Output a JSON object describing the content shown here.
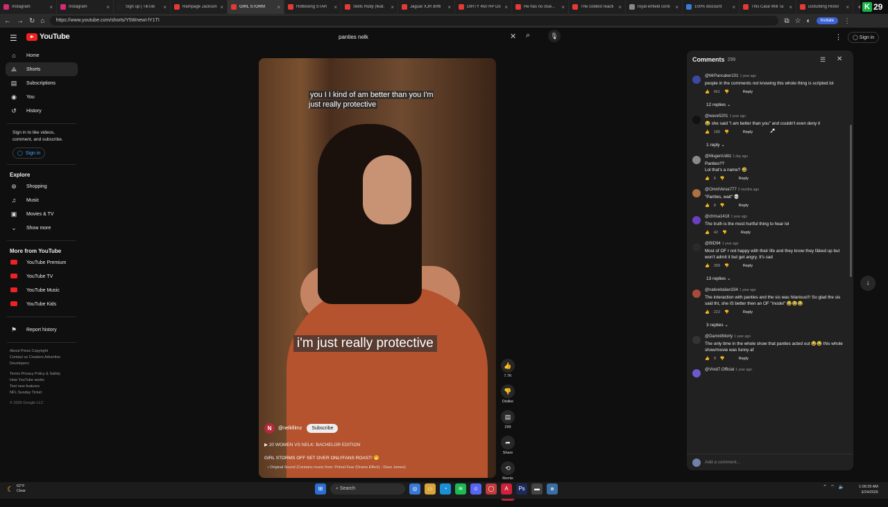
{
  "browser": {
    "tabs": [
      {
        "label": "Instagram",
        "color": "#d62976"
      },
      {
        "label": "Instagram",
        "color": "#d62976"
      },
      {
        "label": "Sign up | TikTok",
        "color": "#222222"
      },
      {
        "label": "Rampage Jackson",
        "color": "#e53935"
      },
      {
        "label": "GIRL STORM",
        "color": "#e53935"
      },
      {
        "label": "Hotboxing STAR",
        "color": "#e53935"
      },
      {
        "label": "Skills Ruby (feat.",
        "color": "#e53935"
      },
      {
        "label": "Jaguar XJR drifti",
        "color": "#e53935"
      },
      {
        "label": "DIRTY 450 HP Do",
        "color": "#e53935"
      },
      {
        "label": "He has no clue...",
        "color": "#e53935"
      },
      {
        "label": "The coldest reacti",
        "color": "#e53935"
      },
      {
        "label": "royal enfield conti",
        "color": "#888888"
      },
      {
        "label": "100% discount",
        "color": "#3a7bd5"
      },
      {
        "label": "This Case Will Ta",
        "color": "#e53935"
      },
      {
        "label": "Disturbing Histor",
        "color": "#e53935"
      }
    ],
    "new_tab": "+",
    "badge_letter": "K",
    "badge_count": "29",
    "url": "https://www.youtube.com/shorts/Y5WnewI-lY1TI",
    "invite_label": "Invitate"
  },
  "header": {
    "logo_text": "YouTube",
    "search_query": "panties nelk",
    "sign_in": "Sign in"
  },
  "sidebar": {
    "primary": [
      {
        "label": "Home",
        "icon": "⌂"
      },
      {
        "label": "Shorts",
        "icon": "⟁"
      },
      {
        "label": "Subscriptions",
        "icon": "▤"
      },
      {
        "label": "You",
        "icon": "◉"
      },
      {
        "label": "History",
        "icon": "↺"
      }
    ],
    "signin_prompt": "Sign in to like videos, comment, and subscribe.",
    "signin_button": "Sign in",
    "explore_title": "Explore",
    "explore": [
      {
        "label": "Shopping",
        "icon": "⊛"
      },
      {
        "label": "Music",
        "icon": "♫"
      },
      {
        "label": "Movies & TV",
        "icon": "▣"
      },
      {
        "label": "Show more",
        "icon": "⌄"
      }
    ],
    "more_title": "More from YouTube",
    "more": [
      {
        "label": "YouTube Premium"
      },
      {
        "label": "YouTube TV"
      },
      {
        "label": "YouTube Music"
      },
      {
        "label": "YouTube Kids"
      }
    ],
    "report": "Report history",
    "footer1": "About  Press  Copyright",
    "footer2": "Contact us  Creators  Advertise",
    "footer3": "Developers",
    "footer4": "Terms  Privacy  Policy & Safety",
    "footer5": "How YouTube works",
    "footer6": "Test new features",
    "footer7": "NFL Sunday Ticket",
    "copyright": "© 2026 Google LLC"
  },
  "video": {
    "caption_top": "you I I kind of am better than you I'm just really protective",
    "caption_main": "i'm just really protective",
    "channel_initial": "N",
    "channel": "@nelkfilmz",
    "subscribe": "Subscribe",
    "playlist": "20 WOMEN VS NELK: BACHELOR EDITION",
    "title": "GIRL STORMS OFF SET OVER ONLYFANS ROAST! 🤭",
    "sound": "Original Sound (Contains music from: Primal Fear (Drams Effect) - Dave James)"
  },
  "actions": {
    "likes": "7.7K",
    "dislike": "Dislike",
    "comments": "299",
    "share": "Share",
    "remix": "Remix"
  },
  "comments": {
    "title": "Comments",
    "count": "299",
    "items": [
      {
        "user": "@MrPancaker101",
        "ago": "1 year ago",
        "text": "people in the comments not knowing this whole thing is scripted lol",
        "likes": "661",
        "reply": "Reply",
        "replies": "12 replies",
        "color": "#3b4aa0"
      },
      {
        "user": "@wave5201",
        "ago": "1 year ago",
        "text": "😂 she said \"i am better than you\" and couldn't even deny it",
        "likes": "185",
        "reply": "Reply",
        "replies": "1 reply",
        "color": "#111111"
      },
      {
        "user": "@MugenUditz",
        "ago": "1 day ago",
        "text": "Panties??\nLol that's a name? 🤣",
        "likes": "6",
        "reply": "Reply",
        "replies": "",
        "color": "#8a8a8a"
      },
      {
        "user": "@OmniVerse777",
        "ago": "2 months ago",
        "text": "\"Panties, wait\" 💀",
        "likes": "8",
        "reply": "Reply",
        "replies": "",
        "color": "#b07040"
      },
      {
        "user": "@chrisa1418",
        "ago": "1 year ago",
        "text": "The truth is the most hurtful thing to hear lol",
        "likes": "42",
        "reply": "Reply",
        "replies": "",
        "color": "#6a3fc0"
      },
      {
        "user": "@BID94",
        "ago": "1 year ago",
        "text": "Most of OF r not happy with their life and they know they f&ked up but won't admit it but get angry. It's sad",
        "likes": "309",
        "reply": "Reply",
        "replies": "13 replies",
        "color": "#2a2a2a"
      },
      {
        "user": "@nativeitalian334",
        "ago": "1 year ago",
        "text": "The interaction with panties and the sis was hilarious!!! So glad the sis said tht, she IS better then an OF \"model\" 😂😂😂",
        "likes": "222",
        "reply": "Reply",
        "replies": "3 replies",
        "color": "#a84a3a"
      },
      {
        "user": "@DamnitMorty",
        "ago": "1 year ago",
        "text": "The only time in the whole show that panties acted out 😂😂 this whole show/movie was funny af",
        "likes": "9",
        "reply": "Reply",
        "replies": "",
        "color": "#333333"
      },
      {
        "user": "@Vivid7.Official",
        "ago": "1 year ago",
        "text": "",
        "likes": "",
        "reply": "",
        "replies": "",
        "color": "#6a5acd"
      }
    ],
    "add_placeholder": "Add a comment..."
  },
  "taskbar": {
    "temp": "62°F",
    "cond": "Clear",
    "search": "Search",
    "time": "1:09:29 AM",
    "date": "3/24/2026"
  }
}
